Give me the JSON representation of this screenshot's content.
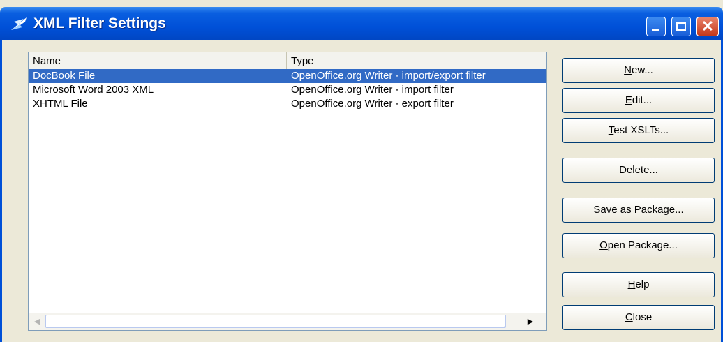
{
  "window": {
    "title": "XML Filter Settings"
  },
  "list": {
    "columns": [
      "Name",
      "Type"
    ],
    "rows": [
      {
        "name": "DocBook File",
        "type": "OpenOffice.org Writer - import/export filter",
        "selected": true
      },
      {
        "name": "Microsoft Word 2003 XML",
        "type": "OpenOffice.org Writer - import filter",
        "selected": false
      },
      {
        "name": "XHTML File",
        "type": "OpenOffice.org Writer - export filter",
        "selected": false
      }
    ]
  },
  "buttons": {
    "new": {
      "access": "N",
      "rest": "ew..."
    },
    "edit": {
      "access": "E",
      "rest": "dit..."
    },
    "test": {
      "access": "T",
      "rest": "est XSLTs..."
    },
    "delete": {
      "access": "D",
      "rest": "elete..."
    },
    "save": {
      "access": "S",
      "rest": "ave as Package..."
    },
    "open": {
      "access": "O",
      "rest": "pen Package..."
    },
    "help": {
      "access": "H",
      "rest": "elp"
    },
    "close": {
      "access": "C",
      "rest": "lose"
    }
  },
  "icons": {
    "app": "xml-filter-icon",
    "minimize": "minimize-icon",
    "maximize": "maximize-icon",
    "close": "close-icon",
    "scroll_left": "arrow-left-icon",
    "scroll_right": "arrow-right-icon"
  },
  "colors": {
    "titlebar": "#0050d8",
    "selection": "#316ac5",
    "face": "#ece9d8"
  }
}
